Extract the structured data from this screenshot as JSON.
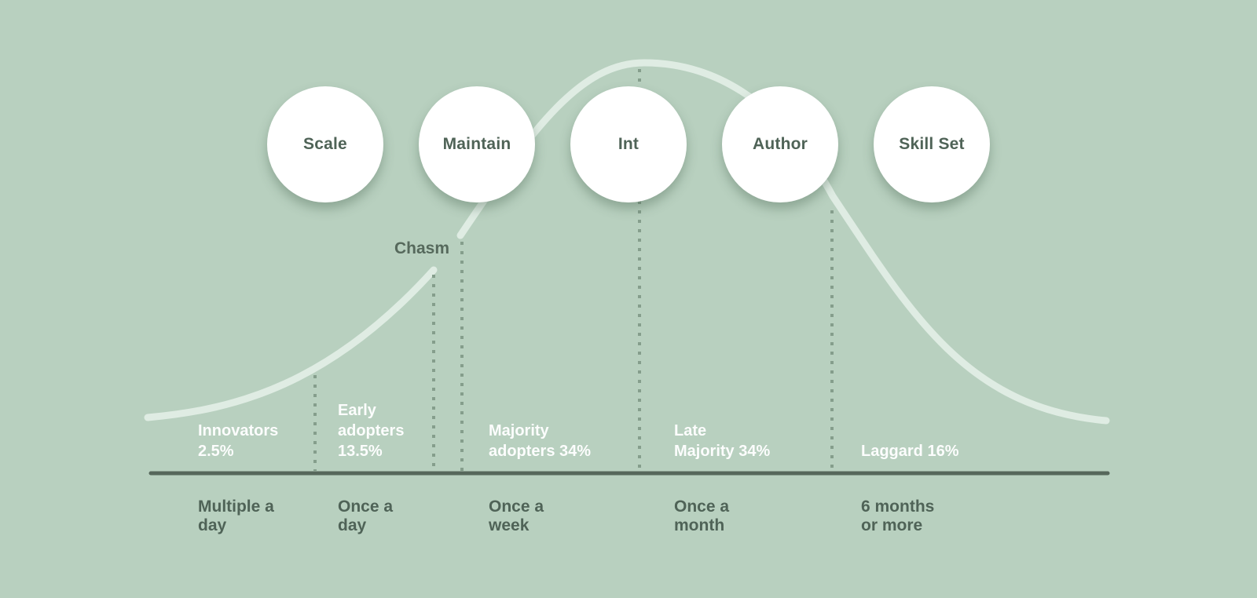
{
  "colors": {
    "background": "#b8d0bf",
    "curve": "#dfece3",
    "axis": "#56675b",
    "divider": "#859e8c",
    "bubble_fill": "#ffffff",
    "bubble_text": "#4f6357",
    "segment_text": "#ffffff",
    "frequency_text": "#4f6357"
  },
  "bubbles": [
    {
      "label": "Scale"
    },
    {
      "label": "Maintain"
    },
    {
      "label": "Int"
    },
    {
      "label": "Author"
    },
    {
      "label": "Skill Set"
    }
  ],
  "chasm": {
    "label": "Chasm"
  },
  "segments": [
    {
      "line1": "Innovators",
      "line2": "2.5%",
      "share_percent": 2.5,
      "frequency_line1": "Multiple a",
      "frequency_line2": "day"
    },
    {
      "line1": "Early",
      "line2": "adopters",
      "line3": "13.5%",
      "share_percent": 13.5,
      "frequency_line1": "Once a",
      "frequency_line2": "day"
    },
    {
      "line1": "Majority",
      "line2": "adopters 34%",
      "share_percent": 34,
      "frequency_line1": "Once a",
      "frequency_line2": "week"
    },
    {
      "line1": "Late",
      "line2": "Majority 34%",
      "share_percent": 34,
      "frequency_line1": "Once a",
      "frequency_line2": "month"
    },
    {
      "line1": "Laggard 16%",
      "share_percent": 16,
      "frequency_line1": "6 months",
      "frequency_line2": "or more"
    }
  ]
}
